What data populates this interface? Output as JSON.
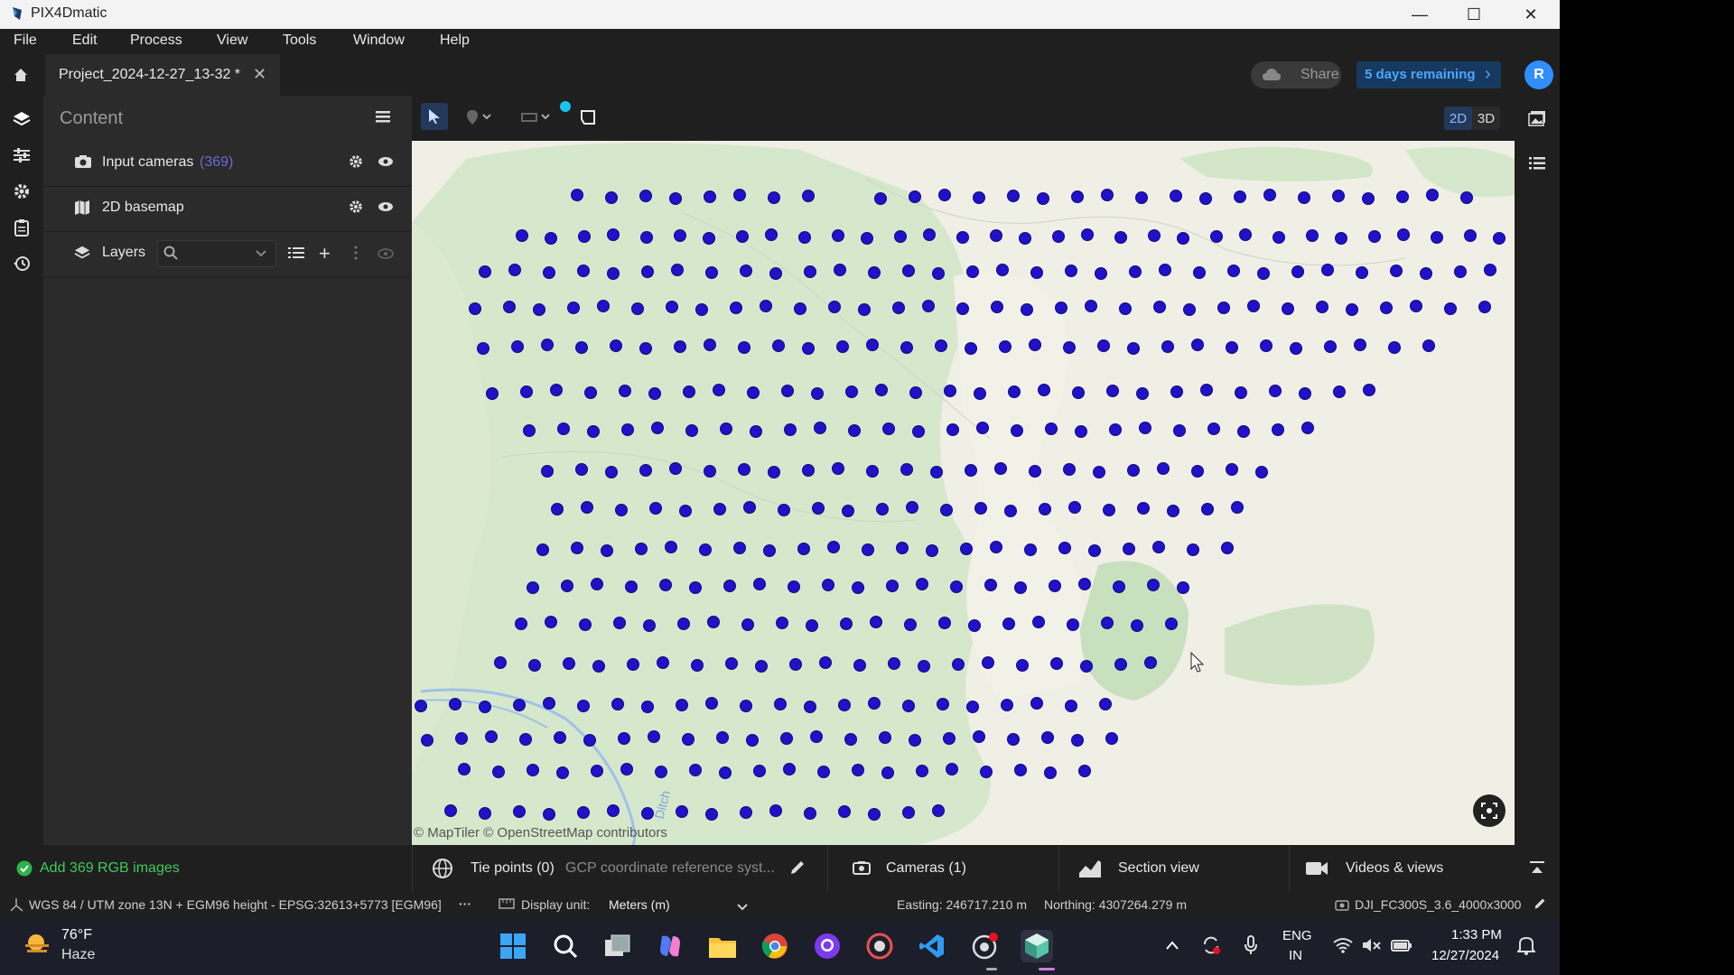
{
  "window": {
    "title": "PIX4Dmatic",
    "minimize": "—",
    "maximize": "☐",
    "close": "✕"
  },
  "menu": [
    "File",
    "Edit",
    "Process",
    "View",
    "Tools",
    "Window",
    "Help"
  ],
  "tab": {
    "label": "Project_2024-12-27_13-32 *",
    "close": "✕"
  },
  "header": {
    "share_label": "Share",
    "trial_label": "5 days remaining",
    "trial_chevron": "›",
    "avatar_initial": "R"
  },
  "panel": {
    "title": "Content",
    "input_cameras": {
      "label": "Input cameras",
      "count": "(369)"
    },
    "basemap": {
      "label": "2D basemap"
    },
    "layers": {
      "label": "Layers",
      "search_placeholder": ""
    }
  },
  "view_toggle": {
    "two_d": "2D",
    "three_d": "3D"
  },
  "map": {
    "attribution": "© MapTiler  © OpenStreetMap contributors",
    "stream_label": "Ditch",
    "colors": {
      "background": "#f0efe6",
      "vegetation": "#cfe3c4",
      "camera_dot": "#1f12c9",
      "stream": "#9ec2e8"
    }
  },
  "bottom": {
    "status": "Add 369 RGB images",
    "tie_points": "Tie points (0)",
    "gcp_crs": "GCP coordinate reference syst...",
    "cameras": "Cameras (1)",
    "section_view": "Section view",
    "videos_views": "Videos & views"
  },
  "status": {
    "crs": "WGS 84 / UTM zone 13N + EGM96 height - EPSG:32613+5773 [EGM96]",
    "more": "···",
    "display_unit_label": "Display unit:",
    "display_unit_value": "Meters (m)",
    "easting": "Easting: 246717.210 m",
    "northing": "Northing: 4307264.279 m",
    "camera_model": "DJI_FC300S_3.6_4000x3000"
  },
  "taskbar": {
    "temperature": "76°F",
    "weather": "Haze",
    "language": "ENG",
    "region": "IN",
    "time": "1:33 PM",
    "date": "12/27/2024"
  }
}
